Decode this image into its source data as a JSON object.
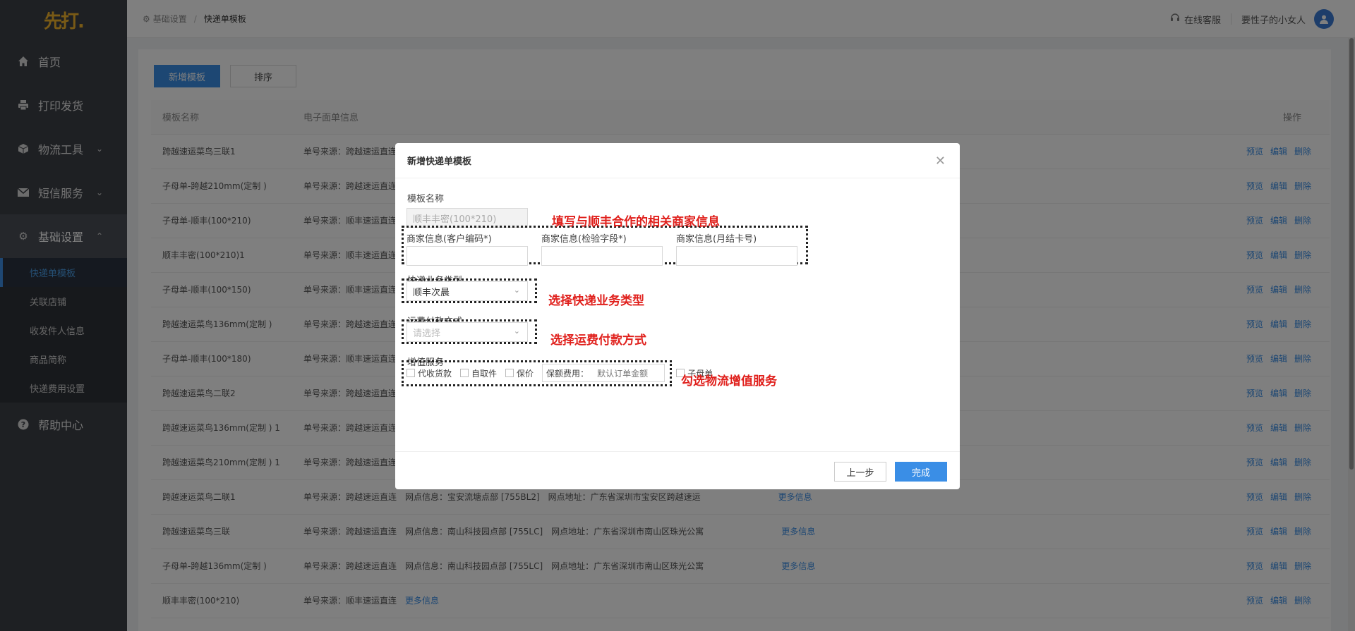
{
  "app": {
    "logo": "先打."
  },
  "sidebar": {
    "items": [
      {
        "label": "首页",
        "icon": "home-icon"
      },
      {
        "label": "打印发货",
        "icon": "printer-icon"
      },
      {
        "label": "物流工具",
        "icon": "cube-icon"
      },
      {
        "label": "短信服务",
        "icon": "mail-icon"
      },
      {
        "label": "基础设置",
        "icon": "gear-icon"
      },
      {
        "label": "帮助中心",
        "icon": "help-icon"
      }
    ],
    "submenu": [
      "快递单模板",
      "关联店铺",
      "收发件人信息",
      "商品简称",
      "快递费用设置"
    ]
  },
  "header": {
    "breadcrumb": [
      "基础设置",
      "快递单模板"
    ],
    "support": "在线客服",
    "user": "要性子的小女人"
  },
  "toolbar": {
    "add_label": "新增模板",
    "sort_label": "排序"
  },
  "table": {
    "columns": [
      "模板名称",
      "电子面单信息",
      "操作"
    ],
    "ops": [
      "预览",
      "编辑",
      "删除"
    ],
    "rows": [
      {
        "name": "跨越速运菜鸟三联1",
        "info": "单号来源：跨越速运直连",
        "outlet": "",
        "addr": "",
        "more": ""
      },
      {
        "name": "子母单-跨越210mm(定制 )",
        "info": "单号来源：跨越速运直连",
        "outlet": "",
        "addr": "",
        "more": ""
      },
      {
        "name": "子母单-顺丰(100*210)",
        "info": "单号来源：顺丰速运直连",
        "outlet": "",
        "addr": "",
        "more": ""
      },
      {
        "name": "顺丰丰密(100*210)1",
        "info": "单号来源：顺丰速运直连",
        "outlet": "",
        "addr": "",
        "more": ""
      },
      {
        "name": "子母单-顺丰(100*150)",
        "info": "单号来源：顺丰速运直连",
        "outlet": "",
        "addr": "",
        "more": ""
      },
      {
        "name": "跨越速运菜鸟136mm(定制 )",
        "info": "单号来源：跨越速运直连",
        "outlet": "",
        "addr": "",
        "more": ""
      },
      {
        "name": "子母单-顺丰(100*180)",
        "info": "单号来源：顺丰速运直连",
        "outlet": "",
        "addr": "",
        "more": ""
      },
      {
        "name": "跨越速运菜鸟二联2",
        "info": "单号来源：跨越速运直连",
        "outlet": "",
        "addr": "",
        "more": ""
      },
      {
        "name": "跨越速运菜鸟136mm(定制 ) 1",
        "info": "单号来源：跨越速运直连",
        "outlet": "",
        "addr": "",
        "more": ""
      },
      {
        "name": "跨越速运菜鸟210mm(定制 ) 1",
        "info": "单号来源：跨越速运直连",
        "outlet": "",
        "addr": "",
        "more": ""
      },
      {
        "name": "跨越速运菜鸟二联1",
        "info": "单号来源：跨越速运直连",
        "outlet": "网点信息：宝安流塘点部 [755BL2]",
        "addr": "网点地址：广东省深圳市宝安区跨越速运",
        "more": "更多信息"
      },
      {
        "name": "跨越速运菜鸟三联",
        "info": "单号来源：跨越速运直连",
        "outlet": "网点信息：南山科技园点部 [755LC]",
        "addr": "网点地址：广东省深圳市南山区珠光公寓",
        "more": "更多信息"
      },
      {
        "name": "子母单-跨越136mm(定制 )",
        "info": "单号来源：跨越速运直连",
        "outlet": "网点信息：南山科技园点部 [755LC]",
        "addr": "网点地址：广东省深圳市南山区珠光公寓",
        "more": "更多信息"
      },
      {
        "name": "顺丰丰密(100*210)",
        "info": "单号来源：顺丰速运直连",
        "outlet": "更多信息",
        "addr": "",
        "more": ""
      }
    ]
  },
  "modal": {
    "title": "新增快递单模板",
    "template_name_label": "模板名称",
    "template_name_value": "顺丰丰密(100*210)",
    "merchant_code_label": "商家信息(客户编码*)",
    "merchant_check_label": "商家信息(检验字段*)",
    "merchant_monthly_label": "商家信息(月结卡号)",
    "service_type_label": "快递业务类型",
    "service_type_value": "顺丰次晨",
    "payment_label": "运费付款方式",
    "payment_placeholder": "请选择",
    "value_added_label": "增值服务",
    "options": [
      "代收货款",
      "自取件",
      "保价"
    ],
    "insure_label": "保额费用：",
    "insure_value": "默认订单金额",
    "sub_order": "子母单",
    "prev_button": "上一步",
    "done_button": "完成"
  },
  "annotations": {
    "merchant": "填写与顺丰合作的相关商家信息",
    "service": "选择快递业务类型",
    "payment": "选择运费付款方式",
    "value_added": "勾选物流增值服务"
  }
}
